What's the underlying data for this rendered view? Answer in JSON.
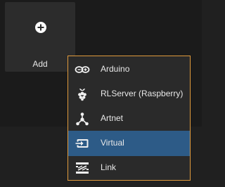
{
  "add_tile": {
    "label": "Add",
    "icon": "plus-circle-icon"
  },
  "menu": {
    "items": [
      {
        "label": "Arduino",
        "icon": "arduino-infinity-icon",
        "selected": false
      },
      {
        "label": "RLServer (Raspberry)",
        "icon": "raspberry-pi-icon",
        "selected": false
      },
      {
        "label": "Artnet",
        "icon": "artnet-node-icon",
        "selected": false
      },
      {
        "label": "Virtual",
        "icon": "virtual-input-icon",
        "selected": true
      },
      {
        "label": "Link",
        "icon": "link-cable-icon",
        "selected": false
      }
    ]
  },
  "colors": {
    "accent_border": "#e09a3c",
    "selected_bg": "#2d5b87",
    "menu_bg": "#2a2a2a",
    "tile_bg": "#2c2c2c"
  }
}
